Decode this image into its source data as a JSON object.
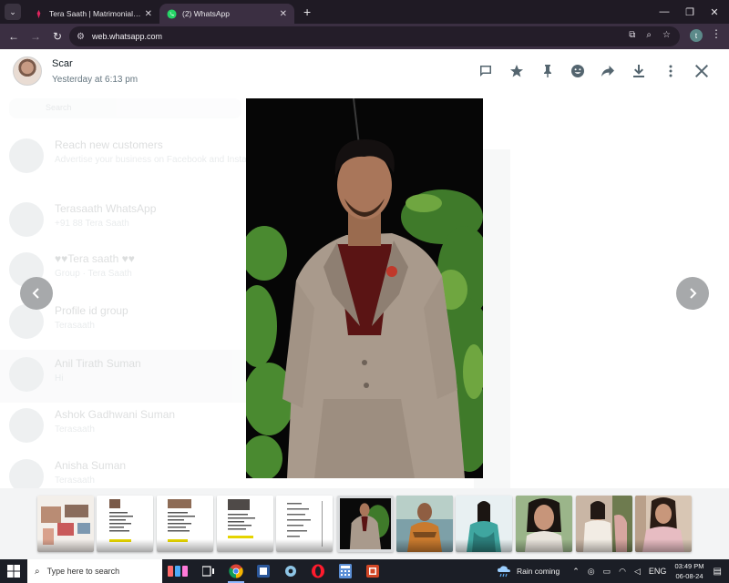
{
  "browser": {
    "tabs": [
      {
        "title": "Tera Saath | Matrimonial Site | E",
        "active": false,
        "favicon": "terasaath-logo-icon"
      },
      {
        "title": "(2) WhatsApp",
        "active": true,
        "favicon": "whatsapp-logo-icon"
      }
    ],
    "url": "web.whatsapp.com",
    "profile_initial": "t"
  },
  "viewer": {
    "contact_name": "Scar",
    "timestamp": "Yesterday at 6:13 pm",
    "header_icons": [
      "message-icon",
      "star-icon",
      "pin-icon",
      "emoji-icon",
      "forward-icon",
      "download-icon",
      "menu-icon",
      "close-icon"
    ]
  },
  "background_chats": {
    "search_placeholder": "Search",
    "items": [
      {
        "name": "Reach new customers",
        "preview": "Advertise your business on Facebook and Instagram."
      },
      {
        "name": "Terasaath WhatsApp",
        "preview": "+91 88 Tera Saath"
      },
      {
        "name": "♥♥Tera saath ♥♥",
        "preview": "Group · Tera Saath"
      },
      {
        "name": "Profile id group",
        "preview": "Terasaath"
      },
      {
        "name": "Anil Tirath Suman",
        "preview": "Hi"
      },
      {
        "name": "Ashok Gadhwani Suman",
        "preview": "Terasaath"
      },
      {
        "name": "Anisha Suman",
        "preview": "Terasaath"
      }
    ]
  },
  "thumbnails": [
    {
      "kind": "collage",
      "selected": false
    },
    {
      "kind": "document",
      "selected": false
    },
    {
      "kind": "document",
      "selected": false
    },
    {
      "kind": "document",
      "selected": false
    },
    {
      "kind": "document",
      "selected": false
    },
    {
      "kind": "photo-man-suit",
      "selected": true
    },
    {
      "kind": "photo-man",
      "selected": false
    },
    {
      "kind": "photo-woman",
      "selected": false
    },
    {
      "kind": "photo-woman",
      "selected": false
    },
    {
      "kind": "photo-woman",
      "selected": false
    },
    {
      "kind": "photo-woman",
      "selected": false
    }
  ],
  "taskbar": {
    "search_placeholder": "Type here to search",
    "weather_text": "Rain coming",
    "language": "ENG",
    "time": "03:49 PM",
    "date": "06-08-24"
  },
  "colors": {
    "accent": "#00a884",
    "tab_strip": "#1f1a24",
    "toolbar": "#3b2f42",
    "arrow": "#a7a9ab"
  }
}
